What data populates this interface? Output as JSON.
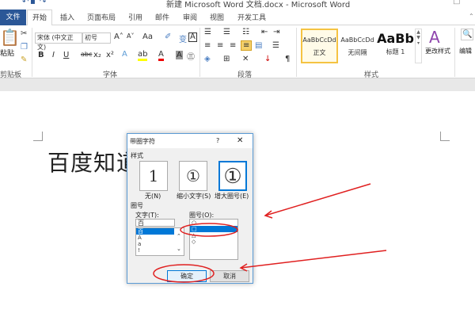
{
  "window": {
    "title": "新建 Microsoft Word 文档.docx - Microsoft Word"
  },
  "tabs": [
    "文件",
    "开始",
    "插入",
    "页面布局",
    "引用",
    "邮件",
    "审阅",
    "视图",
    "开发工具"
  ],
  "ribbon": {
    "clipboard": {
      "paste": "粘贴",
      "label": "剪贴板"
    },
    "font": {
      "name": "宋体 (中文正文)",
      "size": "初号",
      "label": "字体"
    },
    "paragraph": {
      "label": "段落"
    },
    "styles": {
      "label": "样式",
      "items": [
        {
          "preview": "AaBbCcDd",
          "name": "正文"
        },
        {
          "preview": "AaBbCcDd",
          "name": "无间隔"
        },
        {
          "preview": "AaBb",
          "name": "标题 1"
        }
      ],
      "change": "更改样式"
    },
    "editing": {
      "label": "编辑"
    }
  },
  "document": {
    "text": "百度知道"
  },
  "dialog": {
    "title": "带圈字符",
    "help": "?",
    "close": "✕",
    "style_label": "样式",
    "styles": [
      {
        "glyph": "1",
        "label": "无(N)"
      },
      {
        "glyph": "①",
        "label": "缩小文字(S)"
      },
      {
        "glyph": "①",
        "label": "增大圈号(E)",
        "selected": true
      }
    ],
    "circle_label": "圈号",
    "text_label": "文字(T):",
    "text_value": "百",
    "text_items": [
      "百",
      "A",
      "a",
      "!"
    ],
    "enclosure_label": "圈号(O):",
    "enclosure_items": [
      "○",
      "□",
      "△",
      "◇"
    ],
    "selected_enclosure": "□",
    "ok": "确定",
    "cancel": "取消"
  },
  "annotation_color": "#e02020"
}
